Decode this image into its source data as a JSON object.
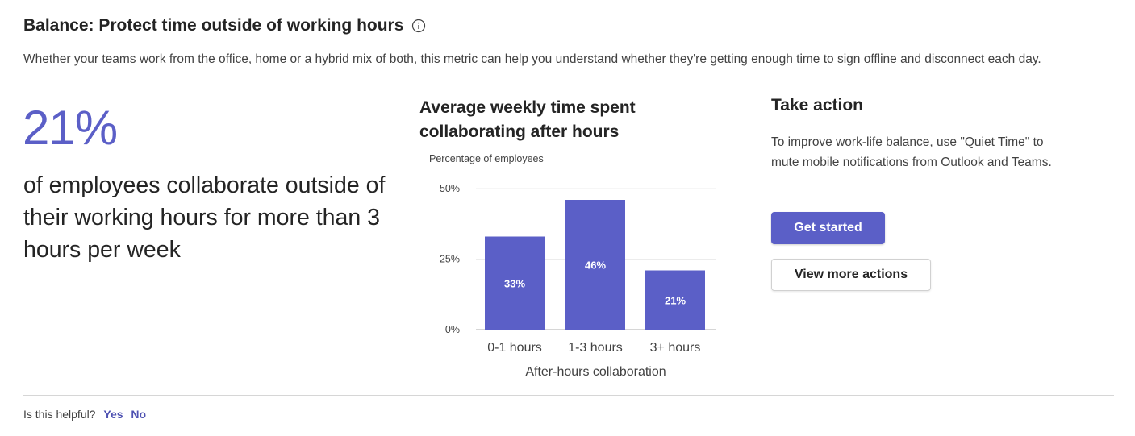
{
  "header": {
    "title": "Balance: Protect time outside of working hours",
    "info_icon": "info-icon",
    "description": "Whether your teams work from the office, home or a hybrid mix of both, this metric can help you understand whether they're getting enough time to sign offline and disconnect each day."
  },
  "stat": {
    "value": "21%",
    "text": "of employees collaborate outside of their working hours for more than 3 hours per week"
  },
  "chart_data": {
    "type": "bar",
    "title": "Average weekly time spent collaborating after hours",
    "ylabel": "Percentage of employees",
    "xlabel": "After-hours collaboration",
    "categories": [
      "0-1 hours",
      "1-3 hours",
      "3+ hours"
    ],
    "values": [
      33,
      46,
      21
    ],
    "data_labels": [
      "33%",
      "46%",
      "21%"
    ],
    "yticks": [
      "50%",
      "25%",
      "0%"
    ],
    "ytick_values": [
      50,
      25,
      0
    ],
    "ylim": [
      0,
      50
    ],
    "grid": true,
    "color": "#5b5fc7"
  },
  "action": {
    "title": "Take action",
    "text": "To improve work-life balance, use \"Quiet Time\" to mute mobile notifications from Outlook and Teams.",
    "primary_label": "Get started",
    "secondary_label": "View more actions"
  },
  "feedback": {
    "question": "Is this helpful?",
    "yes": "Yes",
    "no": "No"
  },
  "colors": {
    "accent": "#5b5fc7",
    "link": "#4f52b2"
  }
}
